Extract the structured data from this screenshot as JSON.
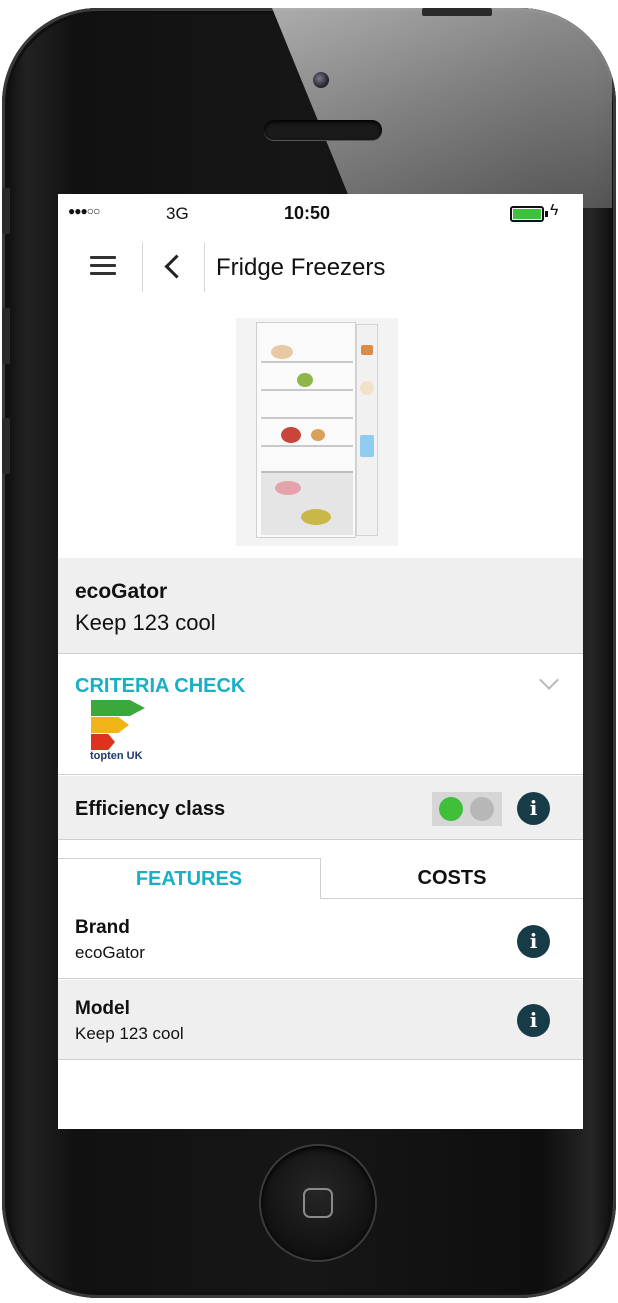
{
  "status_bar": {
    "signal": "●●●○○",
    "network": "3G",
    "time": "10:50",
    "charging_glyph": "ϟ",
    "battery_level": 1.0
  },
  "nav": {
    "title": "Fridge Freezers",
    "menu_icon": "hamburger-menu-icon",
    "back_icon": "chevron-left-icon"
  },
  "product": {
    "brand": "ecoGator",
    "model": "Keep 123 cool",
    "image_icon": "fridge-freezer-photo"
  },
  "criteria": {
    "title": "CRITERIA CHECK",
    "logo_text": "topten UK",
    "expand_icon": "chevron-down-icon"
  },
  "efficiency": {
    "label": "Efficiency class",
    "indicator_colors": [
      "#3fbf3a",
      "#b7b7b7"
    ]
  },
  "tabs": [
    {
      "label": "FEATURES",
      "active": true
    },
    {
      "label": "COSTS",
      "active": false
    }
  ],
  "features": [
    {
      "label": "Brand",
      "value": "ecoGator"
    },
    {
      "label": "Model",
      "value": "Keep 123 cool"
    }
  ],
  "info_glyph": "i",
  "colors": {
    "accent": "#19afc4",
    "info_button": "#173c48",
    "panel_gray": "#efefef"
  }
}
